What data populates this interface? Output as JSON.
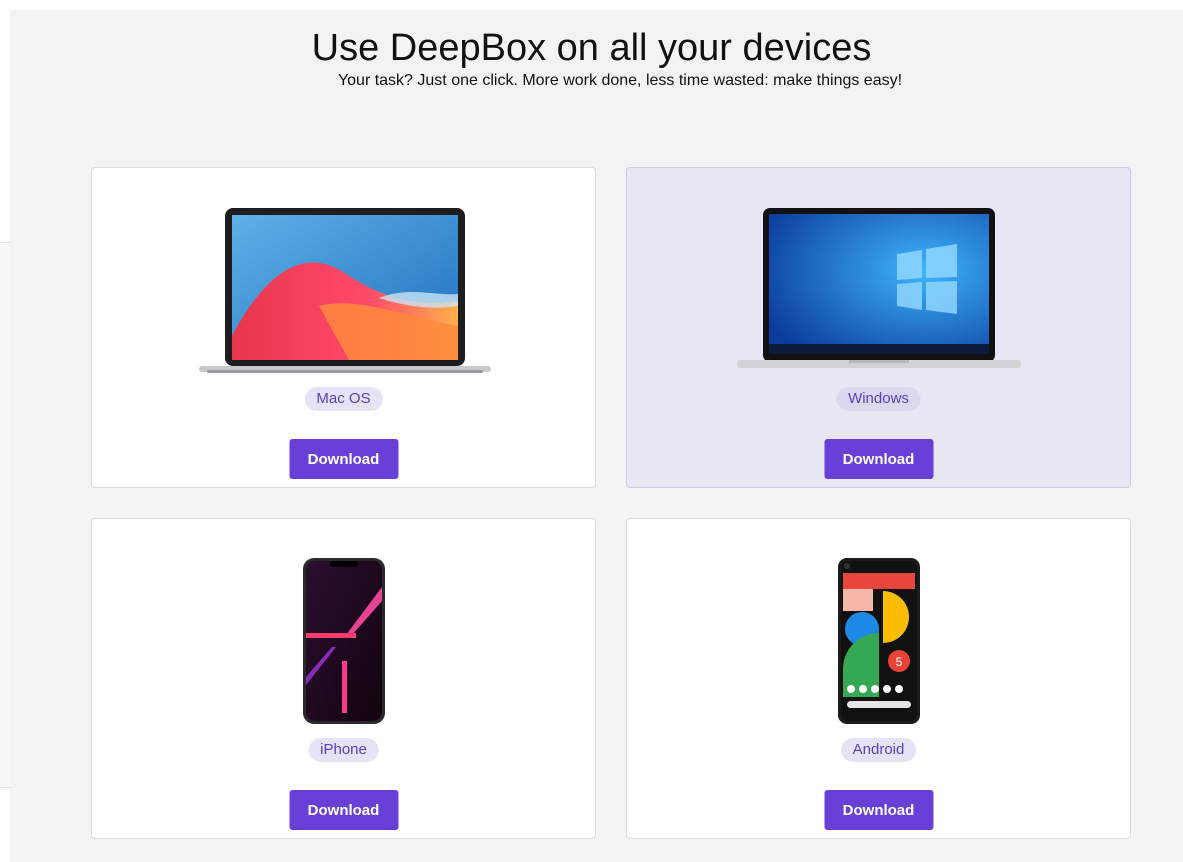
{
  "header": {
    "title": "Use DeepBox on all your devices",
    "subtitle": "Your task? Just one click. More work done, less time wasted: make things easy!"
  },
  "devices": [
    {
      "platform": "Mac OS",
      "button_label": "Download",
      "image": "macbook-image"
    },
    {
      "platform": "Windows",
      "button_label": "Download",
      "image": "windows-laptop-image",
      "highlighted": true
    },
    {
      "platform": "iPhone",
      "button_label": "Download",
      "image": "iphone-image"
    },
    {
      "platform": "Android",
      "button_label": "Download",
      "image": "android-phone-image"
    }
  ],
  "colors": {
    "page_background": "#f3f3f3",
    "card_background": "#ffffff",
    "highlight_card_background": "#e9e7f4",
    "accent": "#6840d8",
    "pill_background": "#e7e3f6",
    "pill_text": "#5b3fc4"
  }
}
